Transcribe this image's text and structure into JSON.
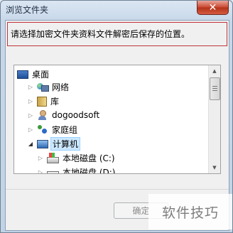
{
  "window": {
    "title": "浏览文件夹",
    "close_symbol": "✕"
  },
  "message": "请选择加密文件夹资料文件解密后保存的位置。",
  "tree": {
    "items": [
      {
        "label": "桌面"
      },
      {
        "label": "网络"
      },
      {
        "label": "库"
      },
      {
        "label": "dogoodsoft"
      },
      {
        "label": "家庭组"
      },
      {
        "label": "计算机"
      },
      {
        "label": "本地磁盘 (C:)"
      },
      {
        "label": "本地磁盘 (D:)"
      }
    ]
  },
  "buttons": {
    "ok_label": "确定"
  },
  "watermark": "软件技巧"
}
